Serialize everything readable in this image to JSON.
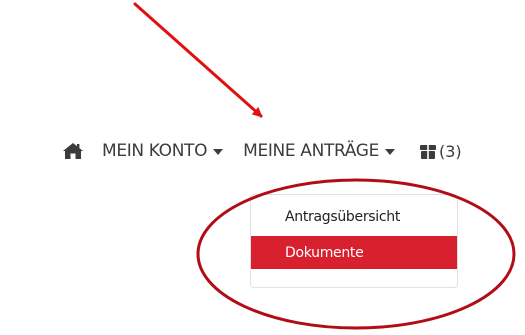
{
  "nav": {
    "home_icon": "home-icon",
    "account_label": "MEIN KONTO",
    "applications_label": "MEINE ANTRÄGE",
    "cart_icon": "package-icon",
    "cart_count": "(3)"
  },
  "dropdown": {
    "items": [
      {
        "label": "Antragsübersicht",
        "active": false
      },
      {
        "label": "Dokumente",
        "active": true
      }
    ]
  },
  "colors": {
    "accent": "#d8202e",
    "annotation": "#b00d16",
    "text": "#3c3c3c",
    "menu_text": "#222222"
  }
}
